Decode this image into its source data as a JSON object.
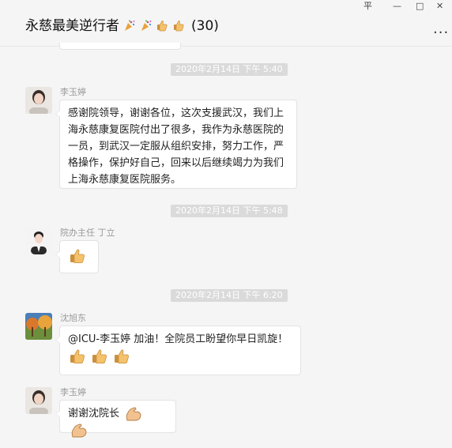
{
  "window": {
    "title": "永慈最美逆行者",
    "count": "(30)",
    "controls": {
      "pin": "平",
      "minimize": "—",
      "maximize": "□",
      "close": "✕"
    },
    "more": "..."
  },
  "messages": [
    {
      "time": "2020年2月14日 下午 5:40",
      "sender": "李玉婷",
      "text": "感谢院领导，谢谢各位，这次支援武汉，我们上海永慈康复医院付出了很多，我作为永慈医院的一员，到武汉一定服从组织安排，努力工作，严格操作，保护好自己，回来以后继续竭力为我们上海永慈康复医院服务。"
    },
    {
      "time": "2020年2月14日 下午 5:48",
      "sender": "院办主任 丁立",
      "emoji": [
        "thumbs-up"
      ]
    },
    {
      "time": "2020年2月14日 下午 6:20",
      "sender": "沈旭东",
      "text": "@ICU-李玉婷 加油！全院员工盼望你早日凯旋！",
      "emoji": [
        "thumbs-up",
        "thumbs-up",
        "thumbs-up"
      ]
    },
    {
      "sender": "李玉婷",
      "text": "谢谢沈院长",
      "emoji": [
        "flexed-biceps",
        "flexed-biceps"
      ]
    }
  ],
  "colors": {
    "background": "#f5f5f5",
    "bubble": "#ffffff",
    "timestamp_bg": "#dadada",
    "sender": "#999999"
  }
}
